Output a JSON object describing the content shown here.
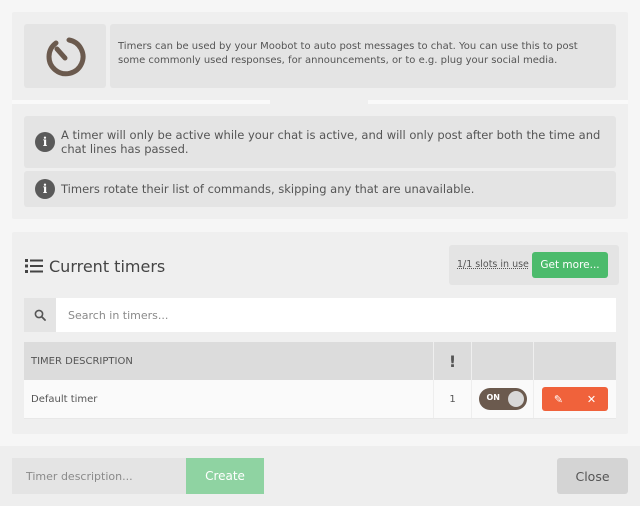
{
  "intro": {
    "icon": "timer-icon",
    "description": "Timers can be used by your Moobot to auto post messages to chat. You can use this to post some commonly used responses, for announcements, or to e.g. plug your social media.",
    "notices": [
      {
        "icon": "info-icon",
        "glyph": "i",
        "text": "A timer will only be active while your chat is active, and will only post after both the time and chat lines has passed."
      },
      {
        "icon": "info-icon",
        "glyph": "i",
        "text": "Timers rotate their list of commands, skipping any that are unavailable."
      }
    ]
  },
  "timers": {
    "title": "Current timers",
    "title_icon": "list-icon",
    "slots_text": "1/1 slots in use",
    "get_more_label": "Get more...",
    "search": {
      "icon": "search-icon",
      "placeholder": "Search in timers...",
      "value": ""
    },
    "table": {
      "headers": {
        "description": "TIMER DESCRIPTION",
        "lines": "!"
      },
      "rows": [
        {
          "description": "Default timer",
          "lines": "1",
          "toggle": "ON",
          "enabled": true
        }
      ]
    }
  },
  "footer": {
    "description_placeholder": "Timer description...",
    "create_label": "Create",
    "close_label": "Close"
  },
  "colors": {
    "accent_green": "#4cbb6c",
    "create_green": "#8fd3a2",
    "danger_orange": "#f0623b",
    "toggle_on": "#6b5a4e"
  },
  "icons": {
    "edit": "pencil-icon",
    "delete": "close-icon",
    "edit_glyph": "✎",
    "delete_glyph": "✕"
  }
}
